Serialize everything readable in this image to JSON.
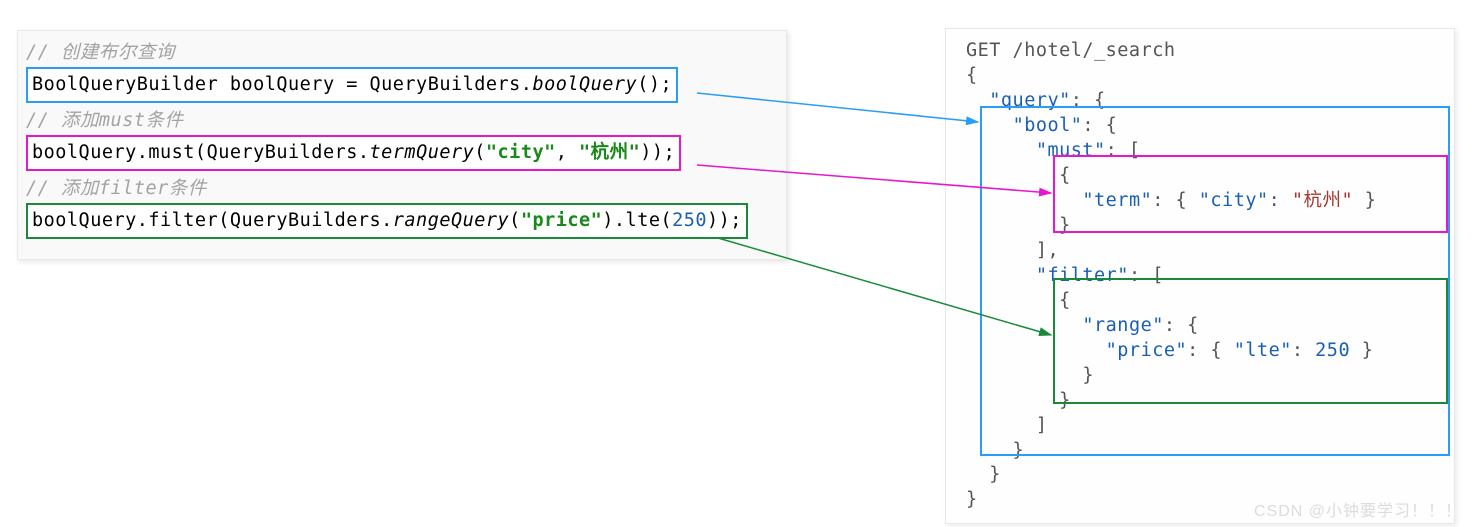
{
  "left": {
    "comment1": "// 创建布尔查询",
    "line1_a": "BoolQueryBuilder boolQuery = QueryBuilders.",
    "line1_b": "boolQuery",
    "line1_c": "();",
    "comment2": "// 添加must条件",
    "line2_a": "boolQuery.must(QueryBuilders.",
    "line2_b": "termQuery",
    "line2_c": "(",
    "line2_d": "\"city\"",
    "line2_e": ", ",
    "line2_f": "\"杭州\"",
    "line2_g": "));",
    "comment3": "// 添加filter条件",
    "line3_a": "boolQuery.filter(QueryBuilders.",
    "line3_b": "rangeQuery",
    "line3_c": "(",
    "line3_d": "\"price\"",
    "line3_e": ").lte(",
    "line3_f": "250",
    "line3_g": "));"
  },
  "right": {
    "l1": "GET /hotel/_search",
    "l2": "{",
    "l3a": "  ",
    "l3b": "\"query\"",
    "l3c": ": {",
    "l4a": "    ",
    "l4b": "\"bool\"",
    "l4c": ": {",
    "l5a": "      ",
    "l5b": "\"must\"",
    "l5c": ": [",
    "l6": "        {",
    "l7a": "          ",
    "l7b": "\"term\"",
    "l7c": ": { ",
    "l7d": "\"city\"",
    "l7e": ": ",
    "l7f": "\"杭州\"",
    "l7g": " }",
    "l8": "        }",
    "l9": "      ],",
    "l10a": "      ",
    "l10b": "\"filter\"",
    "l10c": ": [",
    "l11": "        {",
    "l12a": "          ",
    "l12b": "\"range\"",
    "l12c": ": {",
    "l13a": "            ",
    "l13b": "\"price\"",
    "l13c": ": { ",
    "l13d": "\"lte\"",
    "l13e": ": ",
    "l13f": "250",
    "l13g": " }",
    "l14": "          }",
    "l15": "        }",
    "l16": "      ]",
    "l17": "    }",
    "l18": "  }",
    "l19": "}"
  },
  "watermark": "CSDN @小钟要学习！！！"
}
